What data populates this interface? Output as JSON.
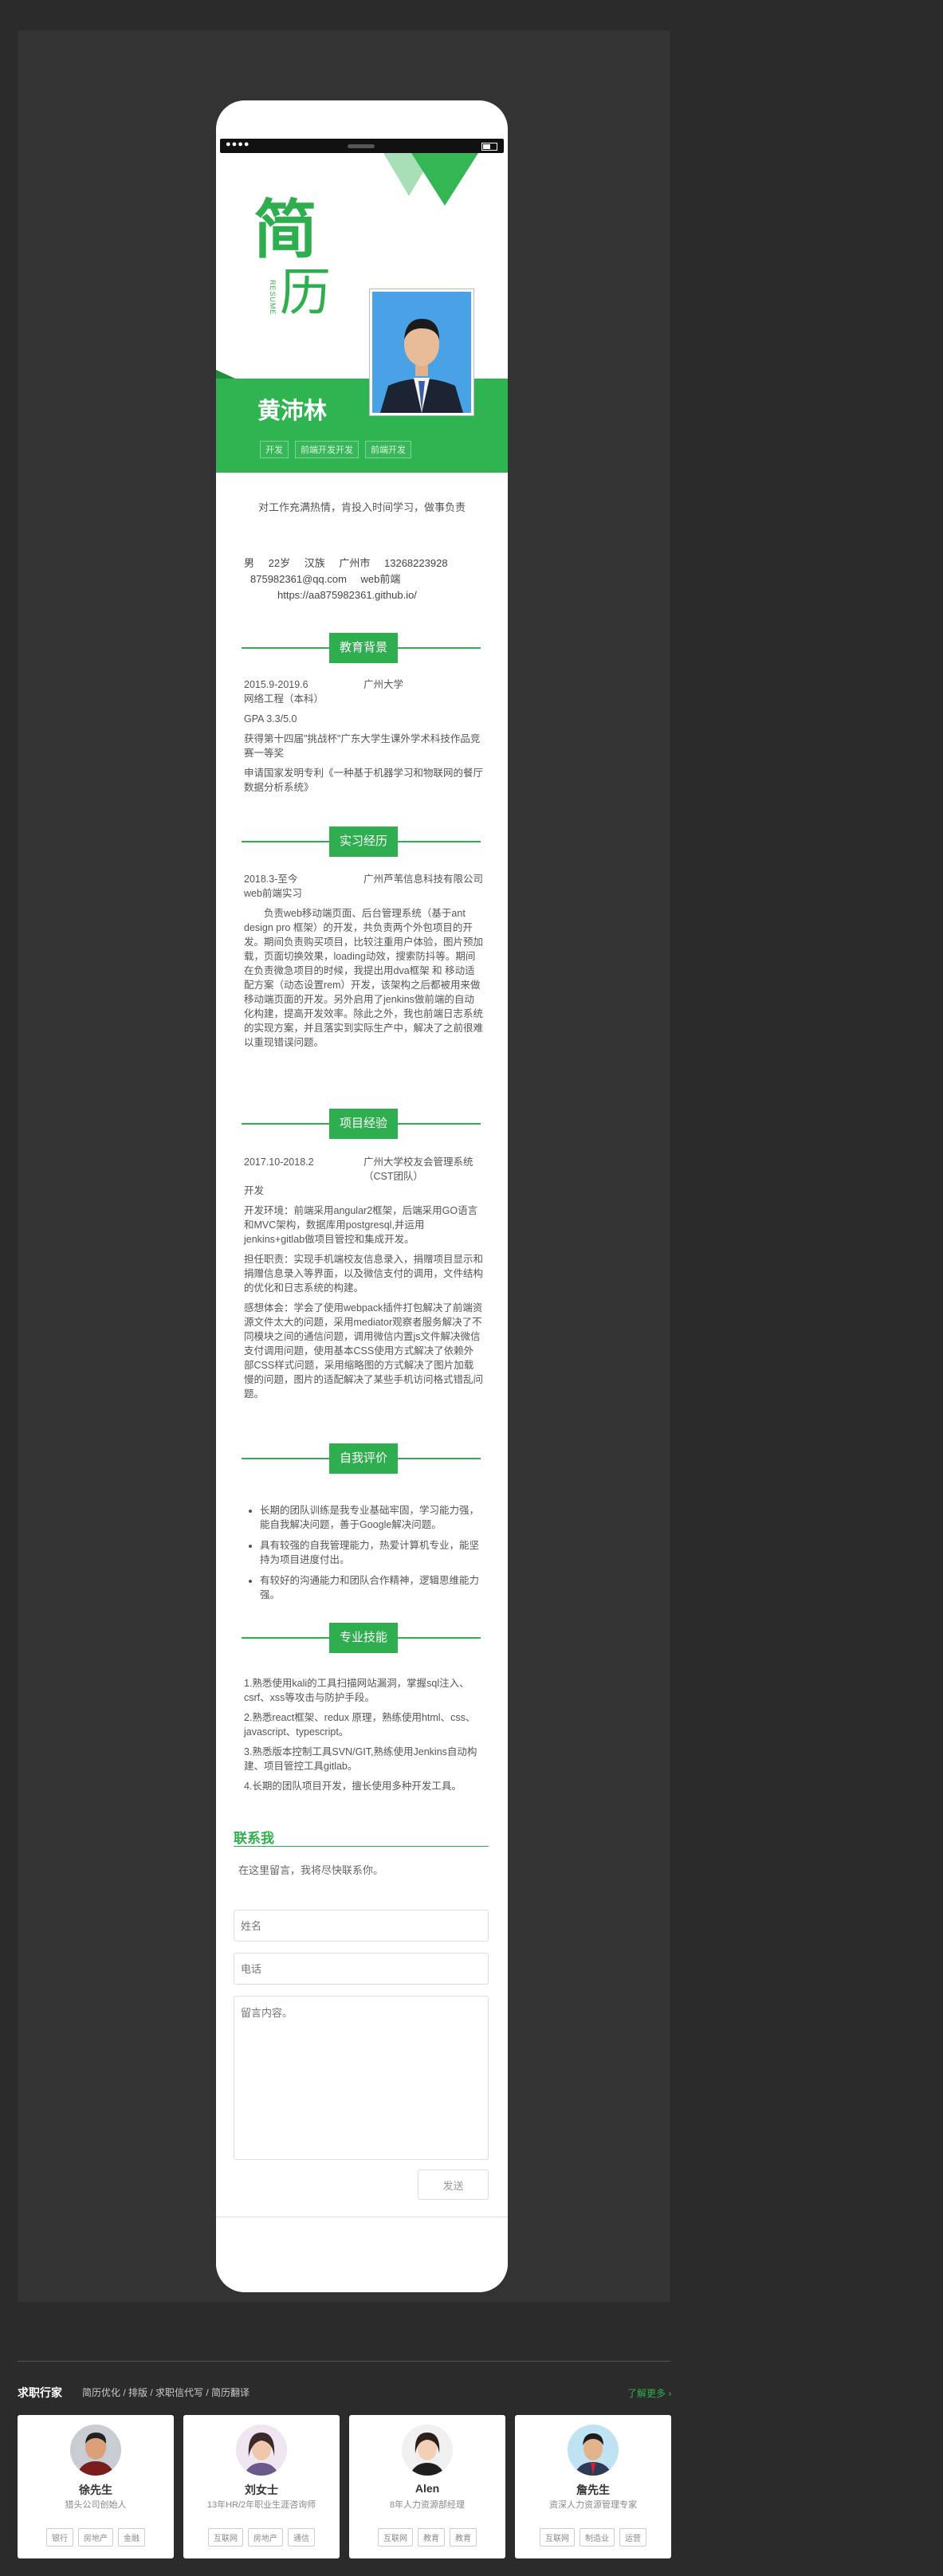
{
  "resume": {
    "big_char_1": "简",
    "big_char_2": "历",
    "resume_en": "RESUME",
    "name": "黄沛林",
    "tags": [
      "开发",
      "前端开发开发",
      "前端开发"
    ],
    "intro": "对工作充满热情，肯投入时间学习，做事负责",
    "info": {
      "gender": "男",
      "age": "22岁",
      "ethnicity": "汉族",
      "city": "广州市",
      "phone": "13268223928",
      "email": "875982361@qq.com",
      "position": "web前端",
      "site": "https://aa875982361.github.io/"
    },
    "sections": {
      "education": "教育背景",
      "internship": "实习经历",
      "projects": "项目经验",
      "self_eval": "自我评价",
      "skills": "专业技能"
    },
    "education": {
      "date": "2015.9-2019.6",
      "school": "广州大学",
      "major": "网络工程（本科）",
      "gpa": "GPA 3.3/5.0",
      "award": "获得第十四届\"挑战杯\"广东大学生课外学术科技作品竞赛一等奖",
      "patent": "申请国家发明专利《一种基于机器学习和物联网的餐厅数据分析系统》"
    },
    "internship": {
      "date": "2018.3-至今",
      "company": "广州芦苇信息科技有限公司",
      "role": "web前端实习",
      "desc": "负责web移动端页面、后台管理系统（基于ant design pro 框架）的开发，共负责两个外包项目的开发。期间负责购买项目，比较注重用户体验，图片预加载，页面切换效果，loading动效，搜索防抖等。期间在负责微急项目的时候，我提出用dva框架 和 移动适配方案（动态设置rem）开发，该架构之后都被用来做移动端页面的开发。另外启用了jenkins做前端的自动化构建，提高开发效率。除此之外，我也前端日志系统的实现方案，并且落实到实际生产中，解决了之前很难以重现错误问题。"
    },
    "project": {
      "date": "2017.10-2018.2",
      "name": "广州大学校友会管理系统（CST团队）",
      "role": "开发",
      "env": "开发环境：前端采用angular2框架，后端采用GO语言和MVC架构，数据库用postgresql,并运用jenkins+gitlab做项目管控和集成开发。",
      "duty": "担任职责：实现手机端校友信息录入，捐赠项目显示和捐赠信息录入等界面，以及微信支付的调用，文件结构的优化和日志系统的构建。",
      "thoughts": "感想体会：学会了使用webpack插件打包解决了前端资源文件太大的问题，采用mediator观察者服务解决了不同模块之间的通信问题，调用微信内置js文件解决微信支付调用问题，使用基本CSS使用方式解决了依赖外部CSS样式问题，采用缩略图的方式解决了图片加载慢的问题，图片的适配解决了某些手机访问格式错乱问题。"
    },
    "self_eval": [
      "长期的团队训练是我专业基础牢固，学习能力强，能自我解决问题，善于Google解决问题。",
      "具有较强的自我管理能力，热爱计算机专业，能坚持为项目进度付出。",
      "有较好的沟通能力和团队合作精神，逻辑思维能力强。"
    ],
    "skills": [
      "1.熟悉使用kali的工具扫描网站漏洞，掌握sql注入、csrf、xss等攻击与防护手段。",
      "2.熟悉react框架、redux 原理，熟练使用html、css、javascript、typescript。",
      "3.熟悉版本控制工具SVN/GIT,熟练使用Jenkins自动构建、项目管控工具gitlab。",
      "4.长期的团队项目开发，擅长使用多种开发工具。"
    ]
  },
  "contact": {
    "title": "联系我",
    "desc": "在这里留言，我将尽快联系你。",
    "name_placeholder": "姓名",
    "phone_placeholder": "电话",
    "message_placeholder": "留言内容。",
    "send": "发送"
  },
  "footer": {
    "title": "求职行家",
    "links": "简历优化 / 排版 / 求职信代写 / 简历翻译",
    "more": "了解更多 ›",
    "cards": [
      {
        "name": "徐先生",
        "title": "猎头公司创始人",
        "tags": [
          "银行",
          "房地产",
          "金融"
        ]
      },
      {
        "name": "刘女士",
        "title": "13年HR/2年职业生涯咨询师",
        "tags": [
          "互联网",
          "房地产",
          "通信"
        ]
      },
      {
        "name": "Alen",
        "title": "8年人力资源部经理",
        "tags": [
          "互联网",
          "教育",
          "教育"
        ]
      },
      {
        "name": "詹先生",
        "title": "资深人力资源管理专家",
        "tags": [
          "互联网",
          "制造业",
          "运营"
        ]
      }
    ]
  },
  "colors": {
    "brand": "#2fae4f",
    "background": "#2b2b2b"
  }
}
